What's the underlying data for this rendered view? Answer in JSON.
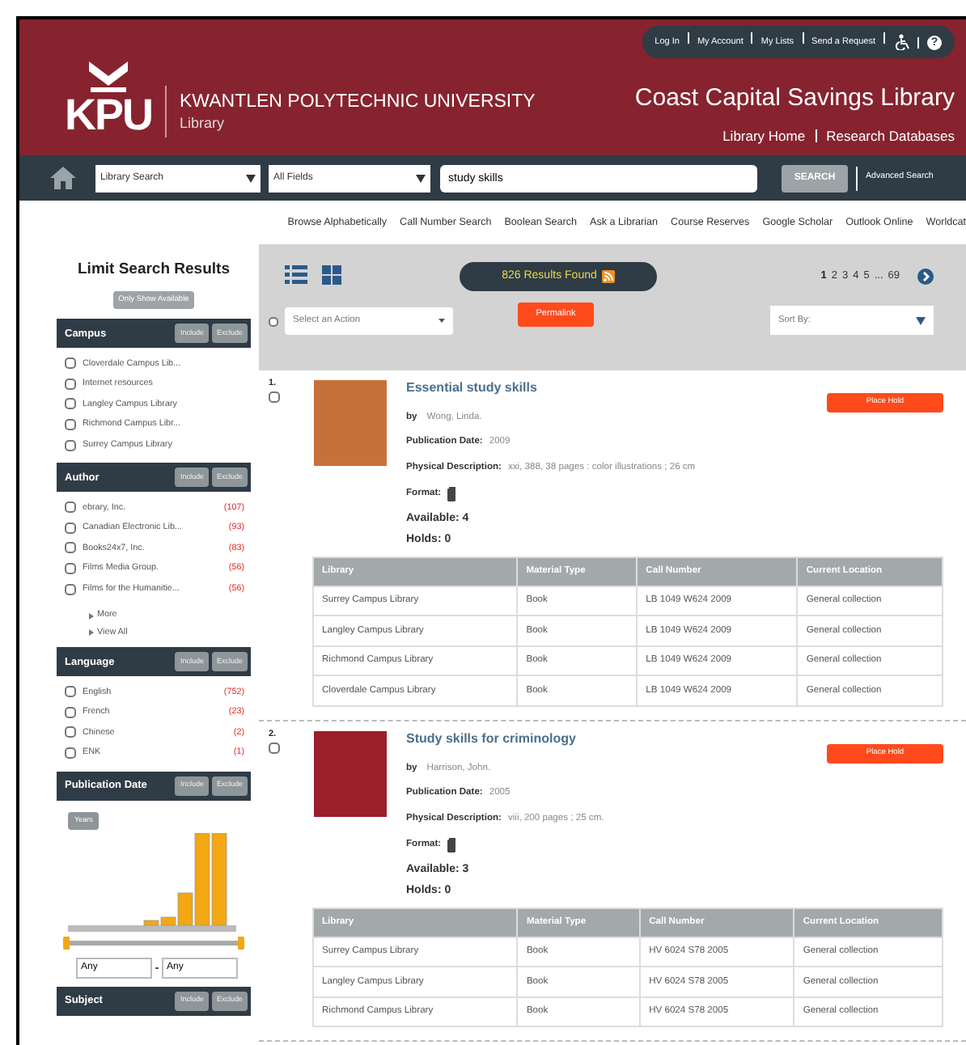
{
  "top_links": [
    "Log In",
    "My Account",
    "My Lists",
    "Send a Request"
  ],
  "help_label": "?",
  "library_name": "Coast Capital Savings Library",
  "logo": {
    "mark": "KPU",
    "university": "KWANTLEN POLYTECHNIC UNIVERSITY",
    "subtitle": "Library"
  },
  "header_links": [
    "Library Home",
    "Research Databases"
  ],
  "search": {
    "scope": "Library Search",
    "field": "All Fields",
    "query": "study skills",
    "button": "SEARCH",
    "advanced": "Advanced Search"
  },
  "nav_links": [
    "Browse Alphabetically",
    "Call Number Search",
    "Boolean Search",
    "Ask a Librarian",
    "Course Reserves",
    "Google Scholar",
    "Outlook Online",
    "Worldcat"
  ],
  "sidebar": {
    "title": "Limit Search Results",
    "available_button": "Only Show Available",
    "facets": [
      {
        "kind": "list",
        "name": "Campus",
        "include": "Include",
        "exclude": "Exclude",
        "items": [
          {
            "label": "Cloverdale Campus Lib...",
            "checked": false
          },
          {
            "label": "Internet resources",
            "checked": false
          },
          {
            "label": "Langley Campus Library",
            "checked": false
          },
          {
            "label": "Richmond Campus Libr...",
            "checked": false
          },
          {
            "label": "Surrey Campus Library",
            "checked": false
          }
        ]
      },
      {
        "kind": "list",
        "name": "Author",
        "include": "Include",
        "exclude": "Exclude",
        "items": [
          {
            "label": "ebrary, Inc.",
            "count": "(107)",
            "checked": false
          },
          {
            "label": "Canadian Electronic Lib...",
            "count": "(93)",
            "checked": false
          },
          {
            "label": "Books24x7, Inc.",
            "count": "(83)",
            "checked": false
          },
          {
            "label": "Films Media Group.",
            "count": "(56)",
            "checked": false
          },
          {
            "label": "Films for the Humanitie...",
            "count": "(56)",
            "checked": false
          }
        ],
        "more": [
          "More",
          "View All"
        ]
      },
      {
        "kind": "list",
        "name": "Language",
        "include": "Include",
        "exclude": "Exclude",
        "items": [
          {
            "label": "English",
            "count": "(752)",
            "checked": false
          },
          {
            "label": "French",
            "count": "(23)",
            "checked": false
          },
          {
            "label": "Chinese",
            "count": "(2)",
            "checked": false
          },
          {
            "label": "ENK",
            "count": "(1)",
            "checked": false
          }
        ]
      },
      {
        "kind": "date",
        "name": "Publication Date",
        "include": "Include",
        "exclude": "Exclude",
        "years_button": "Years",
        "level": 1,
        "from": "Any",
        "to": "Any"
      },
      {
        "kind": "list",
        "name": "Subject",
        "include": "Include",
        "exclude": "Exclude"
      }
    ]
  },
  "toolbar": {
    "results": "826 Results Found",
    "action_placeholder": "Select an Action",
    "action_checked": false,
    "permalink": "Permalink",
    "pages": [
      {
        "label": "1",
        "selected": true
      },
      {
        "label": "2",
        "selected": false
      },
      {
        "label": "3",
        "selected": false
      },
      {
        "label": "4",
        "selected": false
      },
      {
        "label": "5",
        "selected": false
      },
      {
        "label": "...",
        "selected": false
      },
      {
        "label": "69",
        "selected": false
      }
    ],
    "sort": "Sort By:"
  },
  "results": [
    {
      "number": "1.",
      "checked": false,
      "title": "Essential study skills",
      "by_label": "by",
      "author": "Wong, Linda.",
      "fields": [
        {
          "label": "Publication Date:",
          "value": "2009"
        },
        {
          "label": "Physical Description:",
          "value": "xxi, 388, 38 pages : color illustrations ; 26 cm"
        }
      ],
      "format_label": "Format:",
      "available": "Available: 4",
      "holds": "Holds: 0",
      "hold_button": "Place Hold",
      "table": {
        "columns": [
          "Library",
          "Material Type",
          "Call Number",
          "Current Location"
        ],
        "rows": [
          [
            "Surrey Campus Library",
            "Book",
            "LB 1049 W624 2009",
            "General collection"
          ],
          [
            "Langley Campus Library",
            "Book",
            "LB 1049 W624 2009",
            "General collection"
          ],
          [
            "Richmond Campus Library",
            "Book",
            "LB 1049 W624 2009",
            "General collection"
          ],
          [
            "Cloverdale Campus Library",
            "Book",
            "LB 1049 W624 2009",
            "General collection"
          ]
        ]
      }
    },
    {
      "number": "2.",
      "checked": false,
      "title": "Study skills for criminology",
      "by_label": "by",
      "author": "Harrison, John.",
      "fields": [
        {
          "label": "Publication Date:",
          "value": "2005"
        },
        {
          "label": "Physical Description:",
          "value": "viii, 200 pages ; 25 cm."
        }
      ],
      "format_label": "Format:",
      "available": "Available: 3",
      "holds": "Holds: 0",
      "hold_button": "Place Hold",
      "table": {
        "columns": [
          "Library",
          "Material Type",
          "Call Number",
          "Current Location"
        ],
        "rows": [
          [
            "Surrey Campus Library",
            "Book",
            "HV 6024 S78 2005",
            "General collection"
          ],
          [
            "Langley Campus Library",
            "Book",
            "HV 6024 S78 2005",
            "General collection"
          ],
          [
            "Richmond Campus Library",
            "Book",
            "HV 6024 S78 2005",
            "General collection"
          ]
        ]
      }
    }
  ]
}
